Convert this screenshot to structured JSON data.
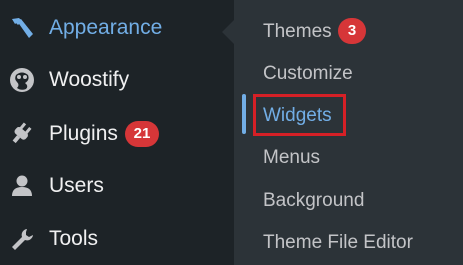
{
  "menu": {
    "items": [
      {
        "label": "Appearance",
        "icon": "paintbrush-icon",
        "current": true
      },
      {
        "label": "Woostify",
        "icon": "woostify-logo-icon"
      },
      {
        "label": "Plugins",
        "icon": "plugin-icon",
        "badge": "21"
      },
      {
        "label": "Users",
        "icon": "user-icon"
      },
      {
        "label": "Tools",
        "icon": "wrench-icon"
      }
    ]
  },
  "submenu": {
    "items": [
      {
        "label": "Themes",
        "badge": "3"
      },
      {
        "label": "Customize"
      },
      {
        "label": "Widgets",
        "current": true,
        "highlighted": true
      },
      {
        "label": "Menus"
      },
      {
        "label": "Background"
      },
      {
        "label": "Theme File Editor"
      }
    ]
  },
  "colors": {
    "menu_bg": "#1d2327",
    "submenu_bg": "#2c3338",
    "accent": "#72aee6",
    "text": "#f0f0f1",
    "submenu_text": "#c3c4c7",
    "badge": "#d63638",
    "highlight_box": "#d62026"
  }
}
